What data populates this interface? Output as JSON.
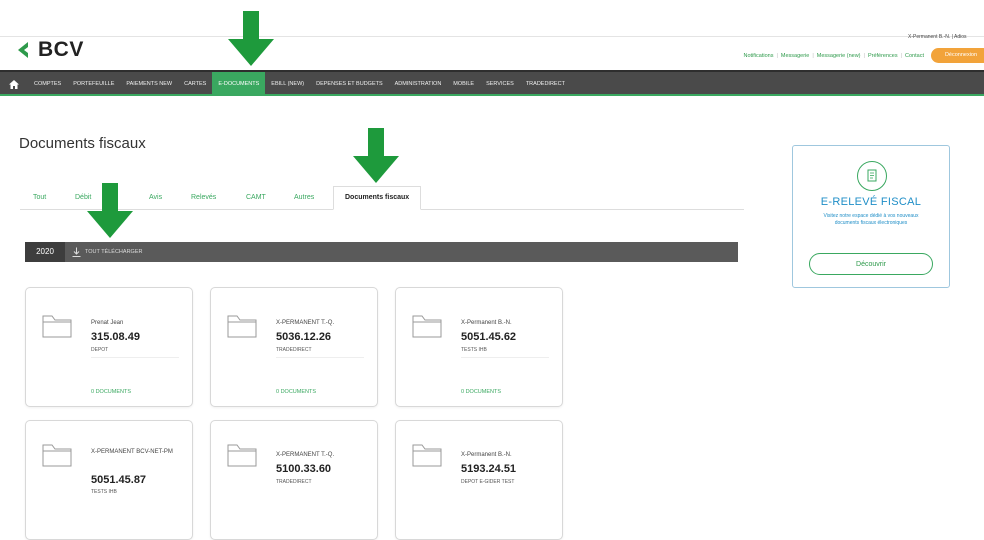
{
  "header": {
    "brand": "BCV",
    "user_chip": "X-Permanent B.-N. | Adios",
    "util_links": [
      "Notifications",
      "Messagerie",
      "Messagerie (new)",
      "Préférences",
      "Contact"
    ],
    "logout_label": "Déconnexion"
  },
  "nav": {
    "items": [
      {
        "label": "COMPTES"
      },
      {
        "label": "PORTEFEUILLE"
      },
      {
        "label": "PAIEMENTS NEW"
      },
      {
        "label": "CARTES"
      },
      {
        "label": "E-DOCUMENTS"
      },
      {
        "label": "EBILL (NEW)"
      },
      {
        "label": "DEPENSES ET BUDGETS"
      },
      {
        "label": "ADMINISTRATION"
      },
      {
        "label": "MOBILE"
      },
      {
        "label": "SERVICES"
      },
      {
        "label": "TRADEDIRECT"
      }
    ],
    "active_index": 4
  },
  "page": {
    "title": "Documents fiscaux",
    "tabs": [
      {
        "label": "Tout"
      },
      {
        "label": "Débit"
      },
      {
        "label": "Avis"
      },
      {
        "label": "Relevés"
      },
      {
        "label": "CAMT"
      },
      {
        "label": "Autres"
      },
      {
        "label": "Documents fiscaux"
      }
    ],
    "active_tab_index": 6
  },
  "yearbar": {
    "year": "2020",
    "download_label": "TOUT TÉLÉCHARGER"
  },
  "cards": [
    {
      "holder": "Prenat Jean",
      "account": "315.08.49",
      "type": "DEPOT",
      "docs": "0 DOCUMENTS"
    },
    {
      "holder": "X-PERMANENT T.-Q.",
      "account": "5036.12.26",
      "type": "TRADEDIRECT",
      "docs": "0 DOCUMENTS"
    },
    {
      "holder": "X-Permanent B.-N.",
      "account": "5051.45.62",
      "type": "TESTS IHB",
      "docs": "0 DOCUMENTS"
    },
    {
      "holder": "X-PERMANENT BCV-NET-PM",
      "account": "5051.45.87",
      "type": "TESTS IHB",
      "docs": ""
    },
    {
      "holder": "X-PERMANENT T.-Q.",
      "account": "5100.33.60",
      "type": "TRADEDIRECT",
      "docs": ""
    },
    {
      "holder": "X-Permanent B.-N.",
      "account": "5193.24.51",
      "type": "DEPOT E-GIDER TEST",
      "docs": ""
    }
  ],
  "promo": {
    "title": "E-RELEVÉ FISCAL",
    "text": "Visitez notre espace dédié à vos nouveaux documents fiscaux électroniques",
    "button": "Découvrir"
  },
  "colors": {
    "brand_green": "#3aa860",
    "nav_dark": "#4a4a4a",
    "promo_blue": "#1f8ec7",
    "logout_orange": "#f2a33a",
    "annotation_arrow": "#1e9a3c"
  },
  "icons": [
    "home-icon",
    "download-icon",
    "folder-icon",
    "document-icon",
    "arrow-down-icon"
  ]
}
